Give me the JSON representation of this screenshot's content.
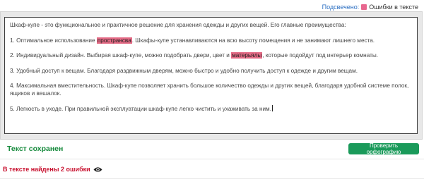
{
  "legend": {
    "label": "Подсвечено:",
    "item": "Ошибки в тексте",
    "swatch_color": "#e8678f"
  },
  "editor": {
    "intro": "Шкаф-купе - это функциональное и практичное решение для хранения одежды и других вещей. Его главные преимущества:",
    "p1_before": "1. Оптимальное использование ",
    "p1_error": "пространсва",
    "p1_after": ". Шкафы-купе устанавливаются на всю высоту помещения и не занимают лишнего места.",
    "p2_before": "2. Индивидуальный дизайн. Выбирая шкаф-купе, можно подобрать двери, цвет и ",
    "p2_error": "матерьялы",
    "p2_after": ", которые подойдут под интерьер комнаты.",
    "p3": "3. Удобный доступ к вещам. Благодаря раздвижным дверям, можно быстро и удобно получить доступ к одежде и другим вещам.",
    "p4": "4. Максимальная вместительность. Шкаф-купе позволяет хранить большое количество одежды и других вещей, благодаря удобной системе полок, ящиков и вешалок.",
    "p5": "5. Легкость в уходе. При правильной эксплуатации шкаф-купе легко чистить и ухаживать за ним."
  },
  "status": {
    "saved": "Текст сохранен"
  },
  "actions": {
    "check_label": "Проверить орфографию"
  },
  "results": {
    "found_text": "В тексте найдены 2 ошибки",
    "toggle_icon": "eye-icon"
  },
  "colors": {
    "error_highlight": "#e46a85",
    "saved_green": "#168a3c",
    "button_green": "#1a9a5a",
    "error_red": "#c8102e",
    "legend_blue": "#2a6ec2"
  }
}
